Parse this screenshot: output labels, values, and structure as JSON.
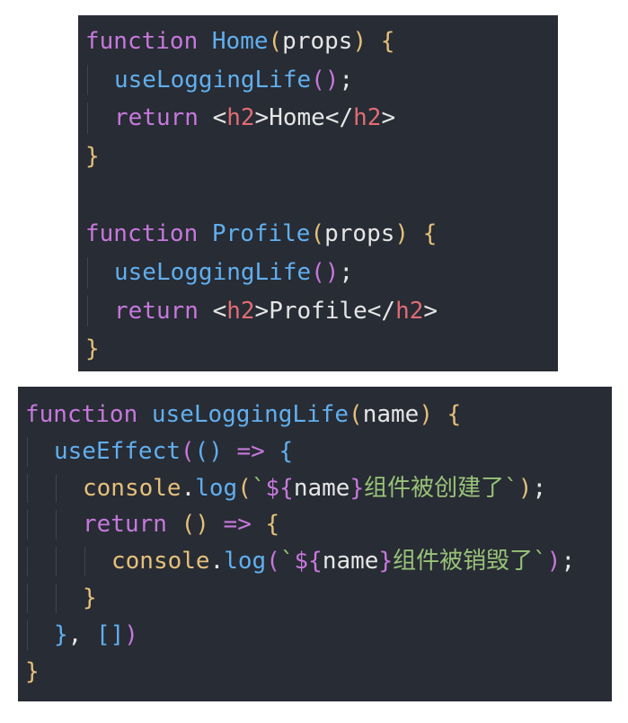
{
  "top_snippet": {
    "home_fn": {
      "keyword": "function",
      "name": "Home",
      "params": "props",
      "call": "useLoggingLife",
      "return_kw": "return",
      "tag_open": "h2",
      "text": "Home",
      "tag_close": "h2"
    },
    "profile_fn": {
      "keyword": "function",
      "name": "Profile",
      "params": "props",
      "call": "useLoggingLife",
      "return_kw": "return",
      "tag_open": "h2",
      "text": "Profile",
      "tag_close": "h2"
    }
  },
  "bottom_snippet": {
    "keyword": "function",
    "name": "useLoggingLife",
    "param": "name",
    "effect_call": "useEffect",
    "arrow": "=>",
    "console_obj": "console",
    "log_method": "log",
    "template_var": "name",
    "created_text": "组件被创建了",
    "return_kw": "return",
    "destroyed_text": "组件被销毁了",
    "deps": "[]"
  },
  "colors": {
    "background": "#282c34",
    "keyword": "#c678dd",
    "function": "#61afef",
    "string": "#98c379",
    "variable": "#e06c75",
    "brace": "#e5c07b"
  }
}
